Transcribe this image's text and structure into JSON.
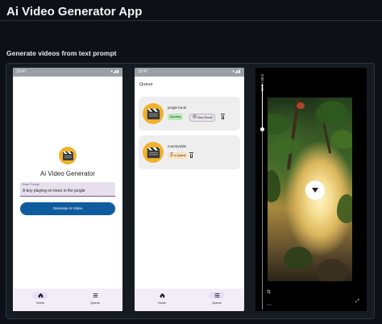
{
  "app": {
    "title": "Ai Video Generator App"
  },
  "section": {
    "subtitle": "Generate videos from text prompt"
  },
  "generator_screen": {
    "status_time": "10:47",
    "status_icons": "▾◢▮",
    "heading": "Ai Video Generator",
    "prompt_label": "Enter Prompt",
    "prompt_value": "A boy playing on trees in the jungle",
    "generate_button": "Generate AI Video",
    "nav": [
      {
        "label": "Home",
        "icon": "home-icon",
        "active": true
      },
      {
        "label": "Queue",
        "icon": "list-icon",
        "active": false
      }
    ]
  },
  "queue_screen": {
    "status_time": "10:47",
    "status_icons": "▾◢▮",
    "title": "Queue",
    "items": [
      {
        "name": "jungle book",
        "status": "Success",
        "action": "View Result"
      },
      {
        "name": "countryside",
        "status": "In Queue"
      }
    ],
    "nav": [
      {
        "label": "Home",
        "icon": "home-icon",
        "active": false
      },
      {
        "label": "Queue",
        "icon": "list-icon",
        "active": true
      }
    ]
  },
  "video_player": {
    "time": "0:00 / 0:05",
    "state": "paused",
    "progress": 0.2
  }
}
